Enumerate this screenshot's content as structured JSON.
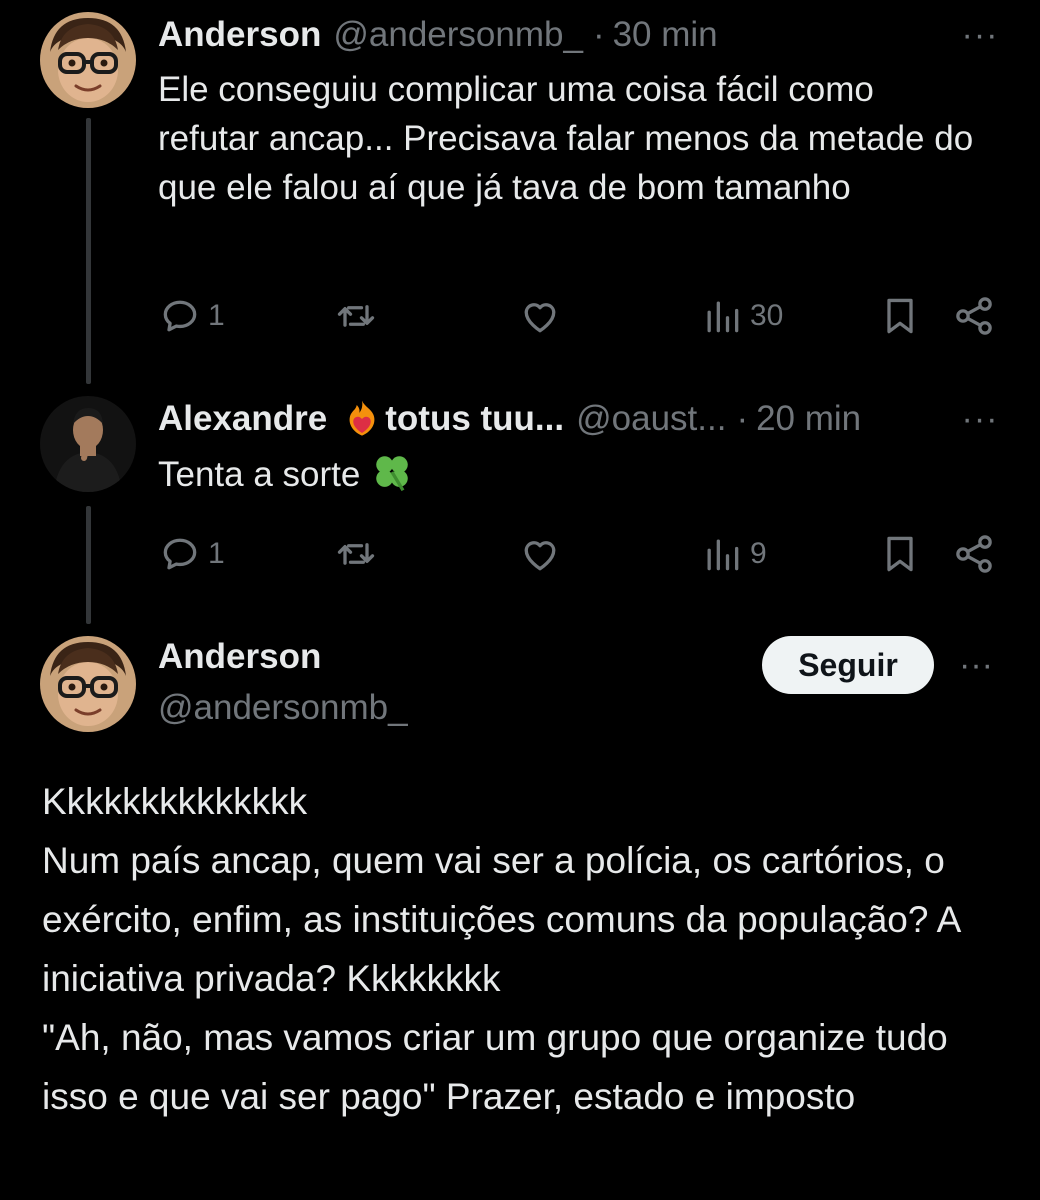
{
  "replies": [
    {
      "name": "Anderson",
      "handle": "@andersonmb_",
      "time": "30 min",
      "more": "···",
      "avatar": "cartoon-glasses-avatar",
      "text": "Ele conseguiu complicar uma coisa fácil como refutar ancap... Precisava falar menos da metade do que ele falou aí que já tava de bom tamanho",
      "replies_count": "1",
      "views": "30"
    },
    {
      "name": "Alexandre",
      "name_rest": "totus tuu...",
      "name_emoji": "flame-heart-icon",
      "handle": "@oaust...",
      "time": "20 min",
      "more": "···",
      "avatar": "photo-avatar",
      "text": "Tenta a sorte",
      "text_emoji": "four-leaf-clover-icon",
      "replies_count": "1",
      "views": "9"
    }
  ],
  "main_post": {
    "name": "Anderson",
    "handle": "@andersonmb_",
    "follow_label": "Seguir",
    "more": "···",
    "lines": [
      "Kkkkkkkkkkkkkk",
      "Num país ancap, quem vai ser a polícia, os cartórios, o exército, enfim, as instituições comuns da população? A iniciativa privada? Kkkkkkkk",
      "\"Ah, não, mas vamos criar um grupo que organize tudo isso e que vai ser pago\" Prazer, estado e imposto"
    ]
  },
  "colors": {
    "background": "#000000",
    "text": "#e7e9ea",
    "muted": "#71767b",
    "thread_line": "#333639",
    "button_bg": "#eff3f4"
  }
}
